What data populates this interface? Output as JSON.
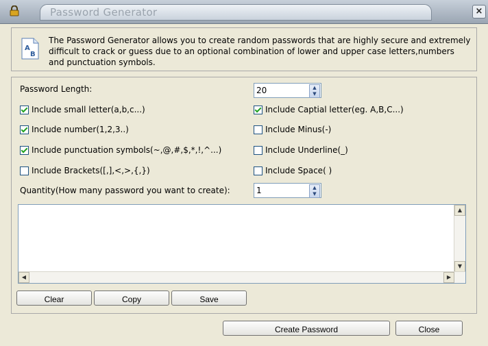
{
  "window": {
    "title": "Password Generator",
    "close_glyph": "×"
  },
  "info": {
    "text": "The Password Generator allows you to create random passwords that are highly secure and extremely difficult to crack or guess due to an optional combination of lower and upper case letters,numbers and punctuation symbols."
  },
  "options": {
    "length_label": "Password Length:",
    "length_value": "20",
    "quantity_label": "Quantity(How many password you want to create):",
    "quantity_value": "1",
    "checkboxes": [
      {
        "label": "Include small letter(a,b,c...)",
        "checked": true
      },
      {
        "label": "Include Captial letter(eg. A,B,C...)",
        "checked": true
      },
      {
        "label": "Include number(1,2,3..)",
        "checked": true
      },
      {
        "label": "Include Minus(-)",
        "checked": false
      },
      {
        "label": "Include punctuation symbols(~,@,#,$,*,!,^...)",
        "checked": true
      },
      {
        "label": "Include Underline(_)",
        "checked": false
      },
      {
        "label": "Include Brackets([,],<,>,{,})",
        "checked": false
      },
      {
        "label": "Include Space( )",
        "checked": false
      }
    ]
  },
  "output": {
    "value": ""
  },
  "buttons": {
    "clear": "Clear",
    "copy": "Copy",
    "save": "Save",
    "create": "Create Password",
    "close": "Close"
  },
  "icons": {
    "lock": "lock-icon",
    "document": "document-ab-icon",
    "spin_up": "▲",
    "spin_down": "▼",
    "scroll_up": "▲",
    "scroll_down": "▼",
    "scroll_left": "◀",
    "scroll_right": "▶"
  },
  "colors": {
    "accent_check": "#21a121",
    "title_text": "#9aa3ad"
  }
}
